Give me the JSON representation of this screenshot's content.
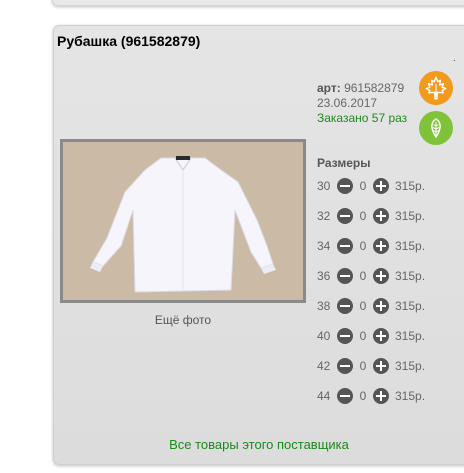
{
  "product": {
    "title": "Рубашка (961582879)",
    "dot": ".",
    "art_label": "арт:",
    "art_value": "961582879",
    "date": "23.06.2017",
    "ordered": "Заказано 57 раз",
    "more_photo": "Ещё фото"
  },
  "badges": [
    {
      "icon": "maple-leaf-icon",
      "color": "#f29a1c"
    },
    {
      "icon": "leaf-icon",
      "color": "#80c239"
    }
  ],
  "sizes_label": "Размеры",
  "sizes": [
    {
      "size": "30",
      "qty": "0",
      "price": "315р."
    },
    {
      "size": "32",
      "qty": "0",
      "price": "315р."
    },
    {
      "size": "34",
      "qty": "0",
      "price": "315р."
    },
    {
      "size": "36",
      "qty": "0",
      "price": "315р."
    },
    {
      "size": "38",
      "qty": "0",
      "price": "315р."
    },
    {
      "size": "40",
      "qty": "0",
      "price": "315р."
    },
    {
      "size": "42",
      "qty": "0",
      "price": "315р."
    },
    {
      "size": "44",
      "qty": "0",
      "price": "315р."
    }
  ],
  "supplier_link": "Все товары этого поставщика"
}
